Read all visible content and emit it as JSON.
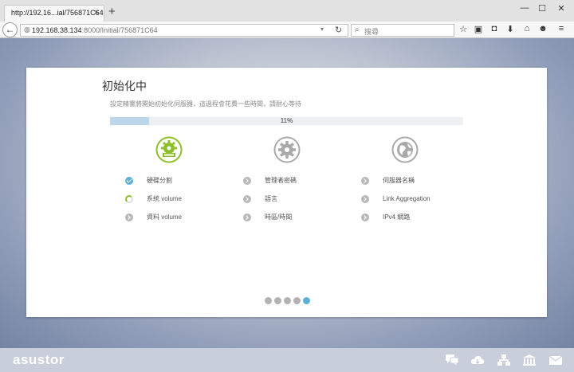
{
  "browser": {
    "tab_title": "http://192.16...ial/756871C64",
    "tab_close": "×",
    "new_tab": "+",
    "window_minimize": "—",
    "window_maximize": "☐",
    "window_close": "✕",
    "back": "←",
    "url_host": "192.168.38.134",
    "url_path": ":8000/Initial/756871C64",
    "url_dropdown": "▾",
    "reload": "↻",
    "search_placeholder": "搜尋",
    "toolbar_icons": [
      "star-icon",
      "reading-list-icon",
      "pocket-icon",
      "download-icon",
      "home-icon",
      "smile-icon",
      "menu-icon"
    ]
  },
  "page": {
    "title": "初始化中",
    "subtitle": "設定精靈將開始初始化伺服器，這過程會花費一些時間，請耐心等待",
    "progress_percent": 11,
    "progress_label": "11%",
    "stages": [
      {
        "name": "storage",
        "icon": "storage-gear-icon",
        "state": "active",
        "color": "#8dbf2a"
      },
      {
        "name": "settings",
        "icon": "gear-icon",
        "state": "pending",
        "color": "#a9a9a9"
      },
      {
        "name": "network",
        "icon": "globe-icon",
        "state": "pending",
        "color": "#a9a9a9"
      }
    ],
    "steps": [
      {
        "label": "硬碟分割",
        "state": "done"
      },
      {
        "label": "系統 volume",
        "state": "running"
      },
      {
        "label": "資料 volume",
        "state": "pending"
      },
      {
        "label": "管理者密碼",
        "state": "pending"
      },
      {
        "label": "語言",
        "state": "pending"
      },
      {
        "label": "時區/時間",
        "state": "pending"
      },
      {
        "label": "伺服器名稱",
        "state": "pending"
      },
      {
        "label": "Link Aggregation",
        "state": "pending"
      },
      {
        "label": "IPv4 網路",
        "state": "pending"
      }
    ],
    "pagination": {
      "total": 5,
      "active": 4
    }
  },
  "footer": {
    "logo": "asustor",
    "icons": [
      "chat-icon",
      "cloud-icon",
      "network-icon",
      "bank-icon",
      "mail-icon"
    ]
  },
  "colors": {
    "accent_green": "#8dbf2a",
    "accent_blue": "#5fb0d6",
    "progress_fill": "#bcd7ec"
  }
}
